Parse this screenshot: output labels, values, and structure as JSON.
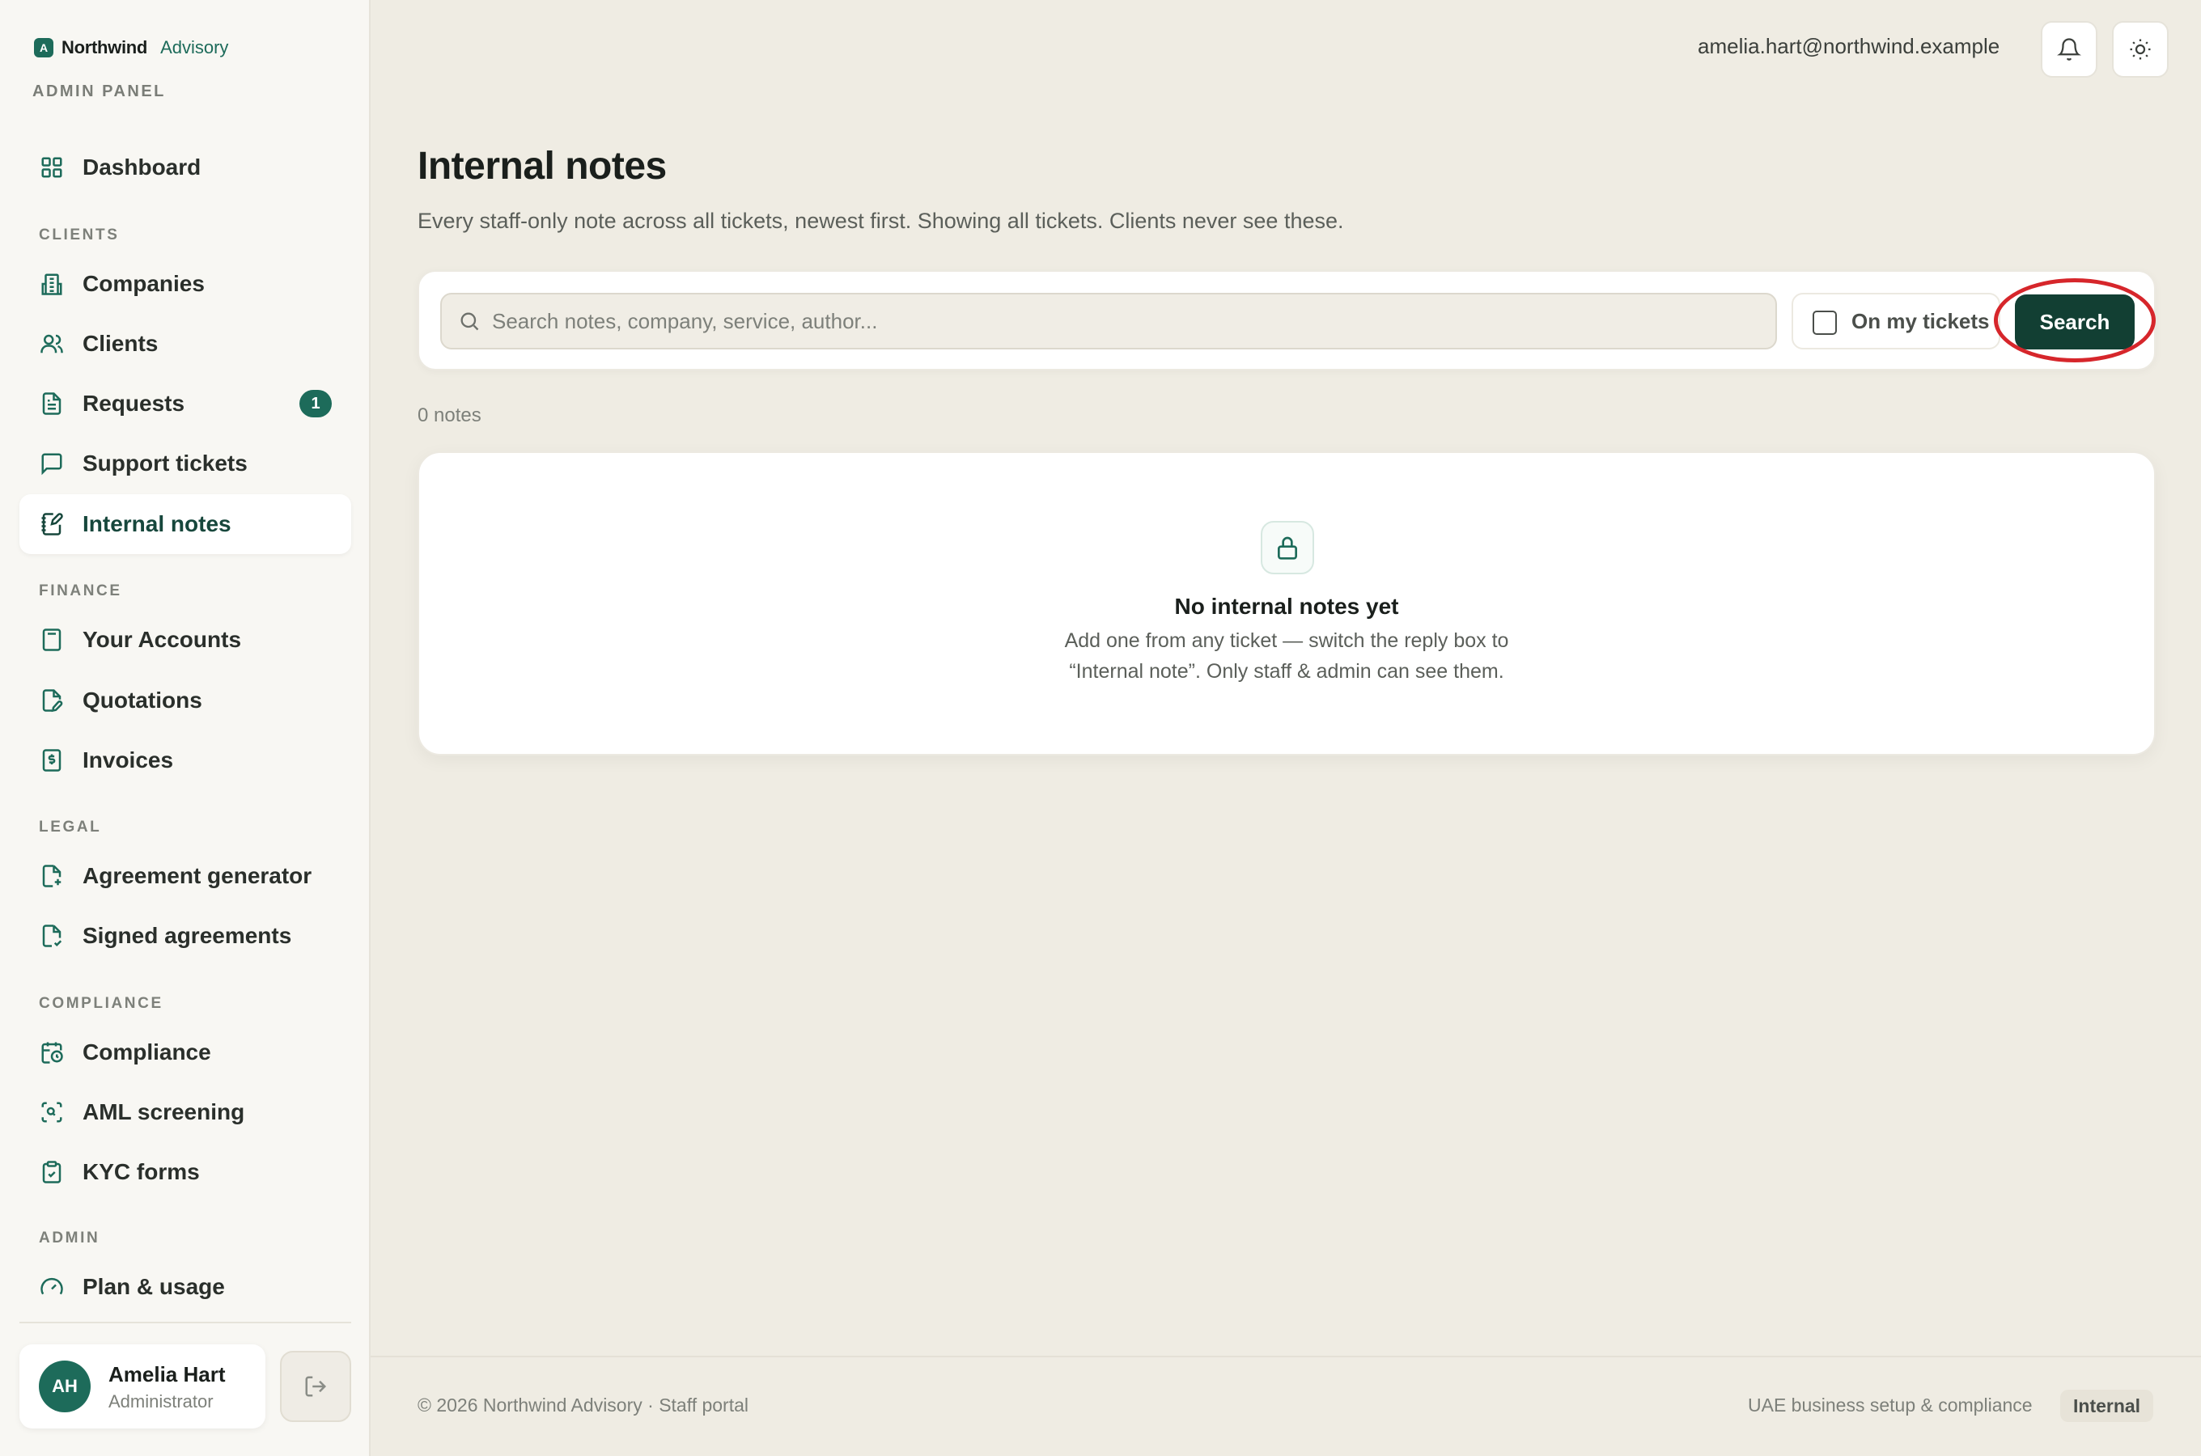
{
  "brand": {
    "logo_letter": "A",
    "name": "Northwind",
    "sub": "Advisory",
    "accent": "#1d6b5a"
  },
  "panel_label": "ADMIN PANEL",
  "nav": {
    "dashboard": {
      "label": "Dashboard",
      "icon": "grid-icon"
    },
    "sections": {
      "clients": "CLIENTS",
      "finance": "FINANCE",
      "legal": "LEGAL",
      "compliance": "COMPLIANCE",
      "admin": "ADMIN"
    },
    "items": {
      "companies": {
        "label": "Companies",
        "icon": "building-icon"
      },
      "clients": {
        "label": "Clients",
        "icon": "users-icon"
      },
      "requests": {
        "label": "Requests",
        "icon": "document-icon",
        "badge": "1"
      },
      "support_tickets": {
        "label": "Support tickets",
        "icon": "chat-icon"
      },
      "internal_notes": {
        "label": "Internal notes",
        "icon": "notebook-icon",
        "active": true
      },
      "your_accounts": {
        "label": "Your Accounts",
        "icon": "calculator-icon"
      },
      "quotations": {
        "label": "Quotations",
        "icon": "file-edit-icon"
      },
      "invoices": {
        "label": "Invoices",
        "icon": "receipt-icon"
      },
      "agreement_generator": {
        "label": "Agreement generator",
        "icon": "file-plus-icon"
      },
      "signed_agreements": {
        "label": "Signed agreements",
        "icon": "file-check-icon"
      },
      "compliance": {
        "label": "Compliance",
        "icon": "calendar-clock-icon"
      },
      "aml_screening": {
        "label": "AML screening",
        "icon": "scan-icon"
      },
      "kyc_forms": {
        "label": "KYC forms",
        "icon": "clipboard-check-icon"
      },
      "plan_usage": {
        "label": "Plan & usage",
        "icon": "gauge-icon"
      }
    }
  },
  "user": {
    "initials": "AH",
    "name": "Amelia Hart",
    "role": "Administrator",
    "email": "amelia.hart@northwind.example"
  },
  "header": {
    "notifications_icon": "bell-icon",
    "theme_icon": "sun-icon",
    "logout_icon": "logout-icon"
  },
  "page": {
    "title": "Internal notes",
    "subtitle": "Every staff-only note across all tickets, newest first. Showing all tickets. Clients never see these."
  },
  "search": {
    "placeholder": "Search notes, company, service, author...",
    "value": "",
    "mine_label": "On my tickets",
    "mine_checked": false,
    "button_label": "Search"
  },
  "results": {
    "count_label": "0 notes",
    "empty_icon": "lock-icon",
    "empty_title": "No internal notes yet",
    "empty_line1": "Add one from any ticket — switch the reply box to",
    "empty_line2": "“Internal note”. Only staff & admin can see them."
  },
  "footer": {
    "copyright": "© 2026 Northwind Advisory · Staff portal",
    "tagline": "UAE business setup & compliance",
    "badge": "Internal"
  },
  "colors": {
    "accent": "#1d6b5a",
    "button": "#123f33",
    "highlight": "#d6262b",
    "background": "#efece3"
  }
}
